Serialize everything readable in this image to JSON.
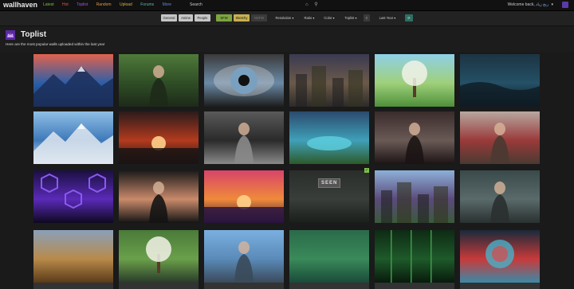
{
  "topbar": {
    "logo": "wallhaven",
    "nav": [
      {
        "label": "Latest",
        "color": "#7fbf4a"
      },
      {
        "label": "Hot",
        "color": "#e0584e"
      },
      {
        "label": "Toplist",
        "color": "#9b59d0"
      },
      {
        "label": "Random",
        "color": "#e09a3e"
      },
      {
        "label": "Upload",
        "color": "#d4b64a"
      },
      {
        "label": "Forums",
        "color": "#5fb5b0"
      },
      {
        "label": "More",
        "color": "#5b8fd8"
      }
    ],
    "search_label": "Search",
    "welcome_text": "Welcome back,",
    "username": "ربح زياد",
    "caret": "▾"
  },
  "filters": {
    "categories": [
      "General",
      "Anime",
      "People"
    ],
    "purity": [
      "SFW",
      "Sketchy",
      "NSFW"
    ],
    "resolution": "Resolution ▾",
    "ratio": "Ratio ▾",
    "color": "Color ▾",
    "sort": "Toplist ▾",
    "order_icon": "≡",
    "range": "Last Year ▾",
    "refresh_icon": "⟳"
  },
  "page": {
    "title": "Toplist",
    "subtitle": "Here are the most popular walls uploaded within the last year"
  },
  "badges": {
    "seen": "SEEN"
  },
  "wallpapers": [
    {
      "name": "mountain-lake-sunset",
      "sky": "#e0624e",
      "mid": "#2c5fa8",
      "ground": "#1b2f5a",
      "motif": "mountain"
    },
    {
      "name": "forest-girl",
      "sky": "#4f7a3a",
      "mid": "#2f4d26",
      "ground": "#1d2a18",
      "motif": "figure"
    },
    {
      "name": "eye-closeup",
      "sky": "#3a3a3a",
      "mid": "#6b8aa6",
      "ground": "#1d1d1d",
      "motif": "eye"
    },
    {
      "name": "city-rooftops",
      "sky": "#3b3a52",
      "mid": "#6b5a4a",
      "ground": "#2d2a2a",
      "motif": "city"
    },
    {
      "name": "cherry-tree-hill",
      "sky": "#8fd0e8",
      "mid": "#9fd07a",
      "ground": "#4f8f3a",
      "motif": "tree"
    },
    {
      "name": "dark-ocean-storm",
      "sky": "#1c3442",
      "mid": "#255066",
      "ground": "#0f1c24",
      "motif": "waves"
    },
    {
      "name": "blue-mountains-rider",
      "sky": "#8fc0e6",
      "mid": "#3e78b8",
      "ground": "#dfe8f0",
      "motif": "mountain"
    },
    {
      "name": "red-sun-valley",
      "sky": "#2b1b1b",
      "mid": "#b33a1e",
      "ground": "#1a1414",
      "motif": "sun"
    },
    {
      "name": "samurai-rain",
      "sky": "#5a5a5a",
      "mid": "#2a2a2a",
      "ground": "#8a8a8a",
      "motif": "figure"
    },
    {
      "name": "crater-lake",
      "sky": "#2b4a6e",
      "mid": "#3fa0b8",
      "ground": "#2d5a2a",
      "motif": "lake"
    },
    {
      "name": "couple-portrait",
      "sky": "#3a2c2c",
      "mid": "#6a5a56",
      "ground": "#1c1414",
      "motif": "figure"
    },
    {
      "name": "girl-at-table",
      "sky": "#b7a7a0",
      "mid": "#9a3a3a",
      "ground": "#4a3a32",
      "motif": "figure"
    },
    {
      "name": "purple-hexagons",
      "sky": "#1b1040",
      "mid": "#5a2ab8",
      "ground": "#0e0820",
      "motif": "hex"
    },
    {
      "name": "girl-back-dark",
      "sky": "#1a1a1a",
      "mid": "#c98a6a",
      "ground": "#141414",
      "motif": "figure"
    },
    {
      "name": "sunset-sea",
      "sky": "#d8446a",
      "mid": "#f08a3a",
      "ground": "#2a1440",
      "motif": "sun"
    },
    {
      "name": "dark-abstract-seen",
      "sky": "#2a2e2a",
      "mid": "#3a3e3a",
      "ground": "#1a1e1a",
      "motif": "plain"
    },
    {
      "name": "village-houses",
      "sky": "#8cb0d8",
      "mid": "#5a4a7a",
      "ground": "#3a5a3a",
      "motif": "city"
    },
    {
      "name": "girl-silhouette-teal",
      "sky": "#3a4a4a",
      "mid": "#5a6a6a",
      "ground": "#2a3030",
      "motif": "figure"
    },
    {
      "name": "pinecone-leaves",
      "sky": "#8aa0b8",
      "mid": "#b88a4a",
      "ground": "#5a3a1a",
      "motif": "plain"
    },
    {
      "name": "waterfall-mill",
      "sky": "#4a7a3a",
      "mid": "#6aa04a",
      "ground": "#2a3a2a",
      "motif": "tree"
    },
    {
      "name": "fisherman-sky",
      "sky": "#7ab0e0",
      "mid": "#5a8ab8",
      "ground": "#3a4a5a",
      "motif": "figure"
    },
    {
      "name": "card-game-green",
      "sky": "#2a6a4a",
      "mid": "#3a8a5a",
      "ground": "#1a4a3a",
      "motif": "plain"
    },
    {
      "name": "green-matrix",
      "sky": "#0e2a14",
      "mid": "#1e5a2a",
      "ground": "#081a0c",
      "motif": "lines"
    },
    {
      "name": "astronaut-orb",
      "sky": "#1a2a3a",
      "mid": "#c83a3a",
      "ground": "#3a8aa8",
      "motif": "orb"
    }
  ]
}
